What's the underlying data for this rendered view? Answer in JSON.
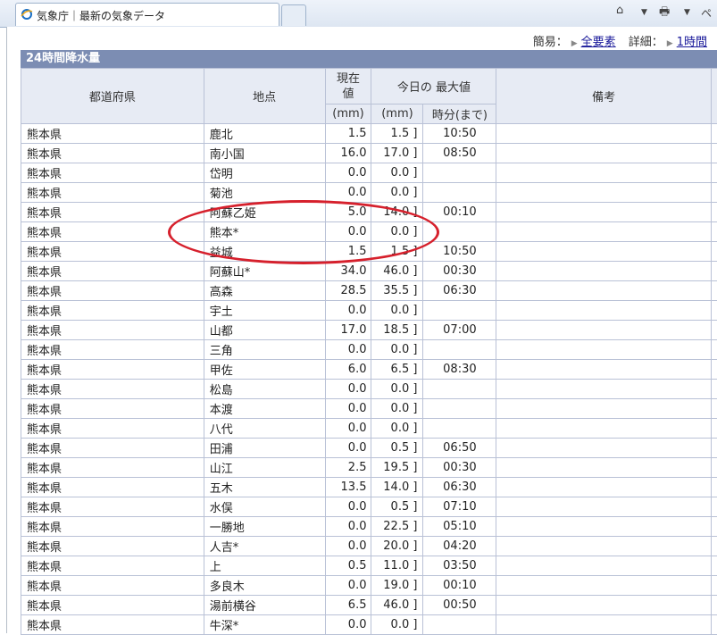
{
  "browser": {
    "tab_title": "気象庁｜最新の気象データ",
    "tool_home": "⌂",
    "tool_print": "🖶",
    "dropdown_arrow": "▼",
    "page_label": "ペ"
  },
  "viewbar": {
    "simple_label": "簡易：",
    "all_elements": "全要素",
    "detail_label": "詳細：",
    "one_hour": "1時間"
  },
  "panel": {
    "title": "24時間降水量"
  },
  "table": {
    "header": {
      "pref": "都道府県",
      "place": "地点",
      "current_line1": "現在",
      "current_line2": "値",
      "today_max": "今日の 最大値",
      "remarks": "備考",
      "unit_mm": "(mm)",
      "unit_mm2": "(mm)",
      "time_until": "時分(まで)"
    },
    "rows": [
      {
        "pref": "熊本県",
        "place": "鹿北",
        "current": "1.5",
        "max": "1.5 ]",
        "time": "10:50"
      },
      {
        "pref": "熊本県",
        "place": "南小国",
        "current": "16.0",
        "max": "17.0 ]",
        "time": "08:50"
      },
      {
        "pref": "熊本県",
        "place": "岱明",
        "current": "0.0",
        "max": "0.0 ]",
        "time": ""
      },
      {
        "pref": "熊本県",
        "place": "菊池",
        "current": "0.0",
        "max": "0.0 ]",
        "time": ""
      },
      {
        "pref": "熊本県",
        "place": "阿蘇乙姫",
        "current": "5.0",
        "max": "14.0 ]",
        "time": "00:10"
      },
      {
        "pref": "熊本県",
        "place": "熊本*",
        "current": "0.0",
        "max": "0.0 ]",
        "time": ""
      },
      {
        "pref": "熊本県",
        "place": "益城",
        "current": "1.5",
        "max": "1.5 ]",
        "time": "10:50"
      },
      {
        "pref": "熊本県",
        "place": "阿蘇山*",
        "current": "34.0",
        "max": "46.0 ]",
        "time": "00:30"
      },
      {
        "pref": "熊本県",
        "place": "高森",
        "current": "28.5",
        "max": "35.5 ]",
        "time": "06:30"
      },
      {
        "pref": "熊本県",
        "place": "宇土",
        "current": "0.0",
        "max": "0.0 ]",
        "time": ""
      },
      {
        "pref": "熊本県",
        "place": "山都",
        "current": "17.0",
        "max": "18.5 ]",
        "time": "07:00"
      },
      {
        "pref": "熊本県",
        "place": "三角",
        "current": "0.0",
        "max": "0.0 ]",
        "time": ""
      },
      {
        "pref": "熊本県",
        "place": "甲佐",
        "current": "6.0",
        "max": "6.5 ]",
        "time": "08:30"
      },
      {
        "pref": "熊本県",
        "place": "松島",
        "current": "0.0",
        "max": "0.0 ]",
        "time": ""
      },
      {
        "pref": "熊本県",
        "place": "本渡",
        "current": "0.0",
        "max": "0.0 ]",
        "time": ""
      },
      {
        "pref": "熊本県",
        "place": "八代",
        "current": "0.0",
        "max": "0.0 ]",
        "time": ""
      },
      {
        "pref": "熊本県",
        "place": "田浦",
        "current": "0.0",
        "max": "0.5 ]",
        "time": "06:50"
      },
      {
        "pref": "熊本県",
        "place": "山江",
        "current": "2.5",
        "max": "19.5 ]",
        "time": "00:30"
      },
      {
        "pref": "熊本県",
        "place": "五木",
        "current": "13.5",
        "max": "14.0 ]",
        "time": "06:30"
      },
      {
        "pref": "熊本県",
        "place": "水俣",
        "current": "0.0",
        "max": "0.5 ]",
        "time": "07:10"
      },
      {
        "pref": "熊本県",
        "place": "一勝地",
        "current": "0.0",
        "max": "22.5 ]",
        "time": "05:10"
      },
      {
        "pref": "熊本県",
        "place": "人吉*",
        "current": "0.0",
        "max": "20.0 ]",
        "time": "04:20"
      },
      {
        "pref": "熊本県",
        "place": "上",
        "current": "0.5",
        "max": "11.0 ]",
        "time": "03:50"
      },
      {
        "pref": "熊本県",
        "place": "多良木",
        "current": "0.0",
        "max": "19.0 ]",
        "time": "00:10"
      },
      {
        "pref": "熊本県",
        "place": "湯前横谷",
        "current": "6.5",
        "max": "46.0 ]",
        "time": "00:50"
      },
      {
        "pref": "熊本県",
        "place": "牛深*",
        "current": "0.0",
        "max": "0.0 ]",
        "time": ""
      }
    ]
  },
  "annotation": {
    "color": "#d6202c"
  }
}
